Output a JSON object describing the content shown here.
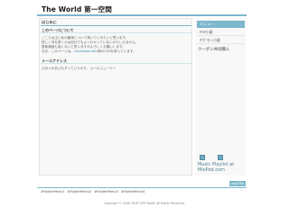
{
  "header": {
    "title": "The World 第一空間"
  },
  "post": {
    "title": "はじめに",
    "sections": [
      {
        "heading": "このページについて",
        "lines": [
          "ここでは主に私の趣味について書いていきたいと思います。",
          "詳しく何を書くかは自分でもよくわかっていないかもしれません。",
          "更新頻度も高くないと思いますがよろしくお願いします。",
          [
            "なお、このページは、",
            "cssnewbandes",
            "様のCSSを使っています。"
          ]
        ]
      },
      {
        "heading": "メールアドレス",
        "lines": [
          "ひみつのあどれすっていうかも　メールジュードー"
        ]
      }
    ]
  },
  "sidebar": {
    "menu_heading": "メニュー",
    "menu_items": [
      "PSP小屋",
      "ポケモン小屋"
    ],
    "sponsor": "クーポン共同購入",
    "music": {
      "title_line1": "Music Playlist at",
      "title_line2": "MixPod.com"
    }
  },
  "page_top_label": "pageTop",
  "footer": {
    "menu": [
      "#FooterMenu1",
      "#FooterMenu2",
      "#FooterMenu3",
      "#FooterMenu4"
    ],
    "copyright": "Copyright © 2006 YOUR SITE NAME All Rights Reserved."
  },
  "colors": {
    "accent": "#7db7cc",
    "link": "#3f8fb3"
  }
}
